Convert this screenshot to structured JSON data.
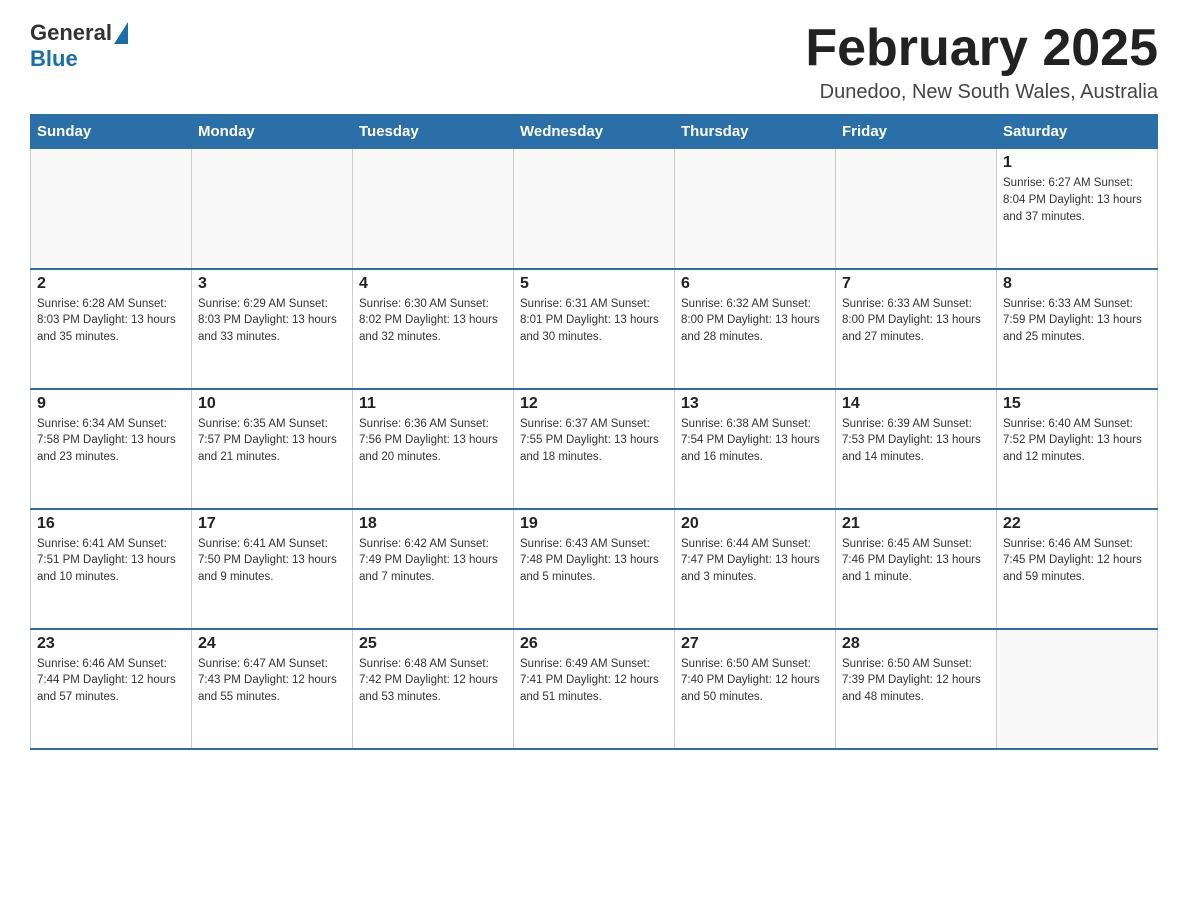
{
  "header": {
    "logo_general": "General",
    "logo_blue": "Blue",
    "month_title": "February 2025",
    "location": "Dunedoo, New South Wales, Australia"
  },
  "days_of_week": [
    "Sunday",
    "Monday",
    "Tuesday",
    "Wednesday",
    "Thursday",
    "Friday",
    "Saturday"
  ],
  "weeks": [
    [
      {
        "day": "",
        "info": ""
      },
      {
        "day": "",
        "info": ""
      },
      {
        "day": "",
        "info": ""
      },
      {
        "day": "",
        "info": ""
      },
      {
        "day": "",
        "info": ""
      },
      {
        "day": "",
        "info": ""
      },
      {
        "day": "1",
        "info": "Sunrise: 6:27 AM\nSunset: 8:04 PM\nDaylight: 13 hours and 37 minutes."
      }
    ],
    [
      {
        "day": "2",
        "info": "Sunrise: 6:28 AM\nSunset: 8:03 PM\nDaylight: 13 hours and 35 minutes."
      },
      {
        "day": "3",
        "info": "Sunrise: 6:29 AM\nSunset: 8:03 PM\nDaylight: 13 hours and 33 minutes."
      },
      {
        "day": "4",
        "info": "Sunrise: 6:30 AM\nSunset: 8:02 PM\nDaylight: 13 hours and 32 minutes."
      },
      {
        "day": "5",
        "info": "Sunrise: 6:31 AM\nSunset: 8:01 PM\nDaylight: 13 hours and 30 minutes."
      },
      {
        "day": "6",
        "info": "Sunrise: 6:32 AM\nSunset: 8:00 PM\nDaylight: 13 hours and 28 minutes."
      },
      {
        "day": "7",
        "info": "Sunrise: 6:33 AM\nSunset: 8:00 PM\nDaylight: 13 hours and 27 minutes."
      },
      {
        "day": "8",
        "info": "Sunrise: 6:33 AM\nSunset: 7:59 PM\nDaylight: 13 hours and 25 minutes."
      }
    ],
    [
      {
        "day": "9",
        "info": "Sunrise: 6:34 AM\nSunset: 7:58 PM\nDaylight: 13 hours and 23 minutes."
      },
      {
        "day": "10",
        "info": "Sunrise: 6:35 AM\nSunset: 7:57 PM\nDaylight: 13 hours and 21 minutes."
      },
      {
        "day": "11",
        "info": "Sunrise: 6:36 AM\nSunset: 7:56 PM\nDaylight: 13 hours and 20 minutes."
      },
      {
        "day": "12",
        "info": "Sunrise: 6:37 AM\nSunset: 7:55 PM\nDaylight: 13 hours and 18 minutes."
      },
      {
        "day": "13",
        "info": "Sunrise: 6:38 AM\nSunset: 7:54 PM\nDaylight: 13 hours and 16 minutes."
      },
      {
        "day": "14",
        "info": "Sunrise: 6:39 AM\nSunset: 7:53 PM\nDaylight: 13 hours and 14 minutes."
      },
      {
        "day": "15",
        "info": "Sunrise: 6:40 AM\nSunset: 7:52 PM\nDaylight: 13 hours and 12 minutes."
      }
    ],
    [
      {
        "day": "16",
        "info": "Sunrise: 6:41 AM\nSunset: 7:51 PM\nDaylight: 13 hours and 10 minutes."
      },
      {
        "day": "17",
        "info": "Sunrise: 6:41 AM\nSunset: 7:50 PM\nDaylight: 13 hours and 9 minutes."
      },
      {
        "day": "18",
        "info": "Sunrise: 6:42 AM\nSunset: 7:49 PM\nDaylight: 13 hours and 7 minutes."
      },
      {
        "day": "19",
        "info": "Sunrise: 6:43 AM\nSunset: 7:48 PM\nDaylight: 13 hours and 5 minutes."
      },
      {
        "day": "20",
        "info": "Sunrise: 6:44 AM\nSunset: 7:47 PM\nDaylight: 13 hours and 3 minutes."
      },
      {
        "day": "21",
        "info": "Sunrise: 6:45 AM\nSunset: 7:46 PM\nDaylight: 13 hours and 1 minute."
      },
      {
        "day": "22",
        "info": "Sunrise: 6:46 AM\nSunset: 7:45 PM\nDaylight: 12 hours and 59 minutes."
      }
    ],
    [
      {
        "day": "23",
        "info": "Sunrise: 6:46 AM\nSunset: 7:44 PM\nDaylight: 12 hours and 57 minutes."
      },
      {
        "day": "24",
        "info": "Sunrise: 6:47 AM\nSunset: 7:43 PM\nDaylight: 12 hours and 55 minutes."
      },
      {
        "day": "25",
        "info": "Sunrise: 6:48 AM\nSunset: 7:42 PM\nDaylight: 12 hours and 53 minutes."
      },
      {
        "day": "26",
        "info": "Sunrise: 6:49 AM\nSunset: 7:41 PM\nDaylight: 12 hours and 51 minutes."
      },
      {
        "day": "27",
        "info": "Sunrise: 6:50 AM\nSunset: 7:40 PM\nDaylight: 12 hours and 50 minutes."
      },
      {
        "day": "28",
        "info": "Sunrise: 6:50 AM\nSunset: 7:39 PM\nDaylight: 12 hours and 48 minutes."
      },
      {
        "day": "",
        "info": ""
      }
    ]
  ]
}
